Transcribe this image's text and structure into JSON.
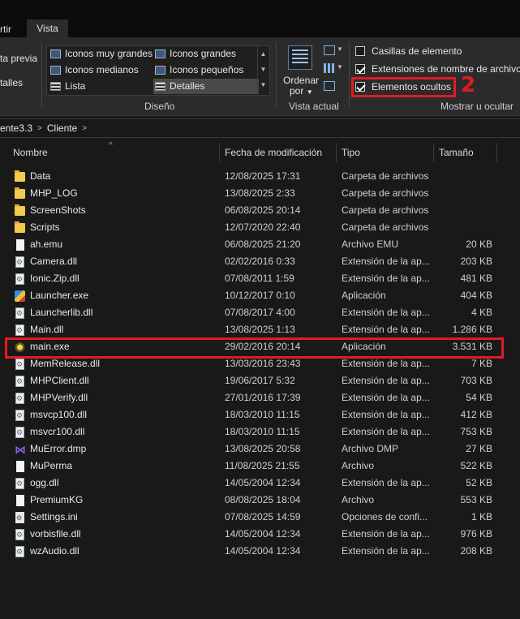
{
  "tabs": {
    "compartir": "rtir",
    "vista": "Vista"
  },
  "ribbon": {
    "panes": {
      "vista_previa": "ta previa",
      "detalles": "talles"
    },
    "layout": {
      "items": [
        {
          "label": "Iconos muy grandes"
        },
        {
          "label": "Iconos grandes"
        },
        {
          "label": "Iconos medianos"
        },
        {
          "label": "Iconos pequeños"
        },
        {
          "label": "Lista"
        },
        {
          "label": "Detalles"
        }
      ],
      "group_label": "Diseño"
    },
    "current_view": {
      "sort_label_1": "Ordenar",
      "sort_label_2": "por",
      "group_label": "Vista actual"
    },
    "show_hide": {
      "checkboxes": [
        {
          "label": "Casillas de elemento",
          "checked": false
        },
        {
          "label": "Extensiones de nombre de archivo",
          "checked": true
        },
        {
          "label": "Elementos ocultos",
          "checked": true
        }
      ],
      "group_label": "Mostrar u ocultar"
    },
    "annotation": "2"
  },
  "address": {
    "crumb1": "ente3.3",
    "crumb2": "Cliente"
  },
  "columns": {
    "name": "Nombre",
    "date": "Fecha de modificación",
    "type": "Tipo",
    "size": "Tamaño"
  },
  "files": [
    {
      "name": "Data",
      "date": "12/08/2025 17:31",
      "type": "Carpeta de archivos",
      "size": "",
      "icon": "folder"
    },
    {
      "name": "MHP_LOG",
      "date": "13/08/2025 2:33",
      "type": "Carpeta de archivos",
      "size": "",
      "icon": "folder"
    },
    {
      "name": "ScreenShots",
      "date": "06/08/2025 20:14",
      "type": "Carpeta de archivos",
      "size": "",
      "icon": "folder"
    },
    {
      "name": "Scripts",
      "date": "12/07/2020 22:40",
      "type": "Carpeta de archivos",
      "size": "",
      "icon": "folder"
    },
    {
      "name": "ah.emu",
      "date": "06/08/2025 21:20",
      "type": "Archivo EMU",
      "size": "20 KB",
      "icon": "file"
    },
    {
      "name": "Camera.dll",
      "date": "02/02/2016 0:33",
      "type": "Extensión de la ap...",
      "size": "203 KB",
      "icon": "dll"
    },
    {
      "name": "Ionic.Zip.dll",
      "date": "07/08/2011 1:59",
      "type": "Extensión de la ap...",
      "size": "481 KB",
      "icon": "dll"
    },
    {
      "name": "Launcher.exe",
      "date": "10/12/2017 0:10",
      "type": "Aplicación",
      "size": "404 KB",
      "icon": "exe"
    },
    {
      "name": "Launcherlib.dll",
      "date": "07/08/2017 4:00",
      "type": "Extensión de la ap...",
      "size": "4 KB",
      "icon": "dll"
    },
    {
      "name": "Main.dll",
      "date": "13/08/2025 1:13",
      "type": "Extensión de la ap...",
      "size": "1.286 KB",
      "icon": "dll"
    },
    {
      "name": "main.exe",
      "date": "29/02/2016 20:14",
      "type": "Aplicación",
      "size": "3.531 KB",
      "icon": "main"
    },
    {
      "name": "MemRelease.dll",
      "date": "13/03/2016 23:43",
      "type": "Extensión de la ap...",
      "size": "7 KB",
      "icon": "dll"
    },
    {
      "name": "MHPClient.dll",
      "date": "19/06/2017 5:32",
      "type": "Extensión de la ap...",
      "size": "703 KB",
      "icon": "dll"
    },
    {
      "name": "MHPVerify.dll",
      "date": "27/01/2016 17:39",
      "type": "Extensión de la ap...",
      "size": "54 KB",
      "icon": "dll"
    },
    {
      "name": "msvcp100.dll",
      "date": "18/03/2010 11:15",
      "type": "Extensión de la ap...",
      "size": "412 KB",
      "icon": "dll"
    },
    {
      "name": "msvcr100.dll",
      "date": "18/03/2010 11:15",
      "type": "Extensión de la ap...",
      "size": "753 KB",
      "icon": "dll"
    },
    {
      "name": "MuError.dmp",
      "date": "13/08/2025 20:58",
      "type": "Archivo DMP",
      "size": "27 KB",
      "icon": "dmp"
    },
    {
      "name": "MuPerma",
      "date": "11/08/2025 21:55",
      "type": "Archivo",
      "size": "522 KB",
      "icon": "file"
    },
    {
      "name": "ogg.dll",
      "date": "14/05/2004 12:34",
      "type": "Extensión de la ap...",
      "size": "52 KB",
      "icon": "dll"
    },
    {
      "name": "PremiumKG",
      "date": "08/08/2025 18:04",
      "type": "Archivo",
      "size": "553 KB",
      "icon": "file"
    },
    {
      "name": "Settings.ini",
      "date": "07/08/2025 14:59",
      "type": "Opciones de confi...",
      "size": "1 KB",
      "icon": "ini"
    },
    {
      "name": "vorbisfile.dll",
      "date": "14/05/2004 12:34",
      "type": "Extensión de la ap...",
      "size": "976 KB",
      "icon": "dll"
    },
    {
      "name": "wzAudio.dll",
      "date": "14/05/2004 12:34",
      "type": "Extensión de la ap...",
      "size": "208 KB",
      "icon": "dll"
    }
  ]
}
